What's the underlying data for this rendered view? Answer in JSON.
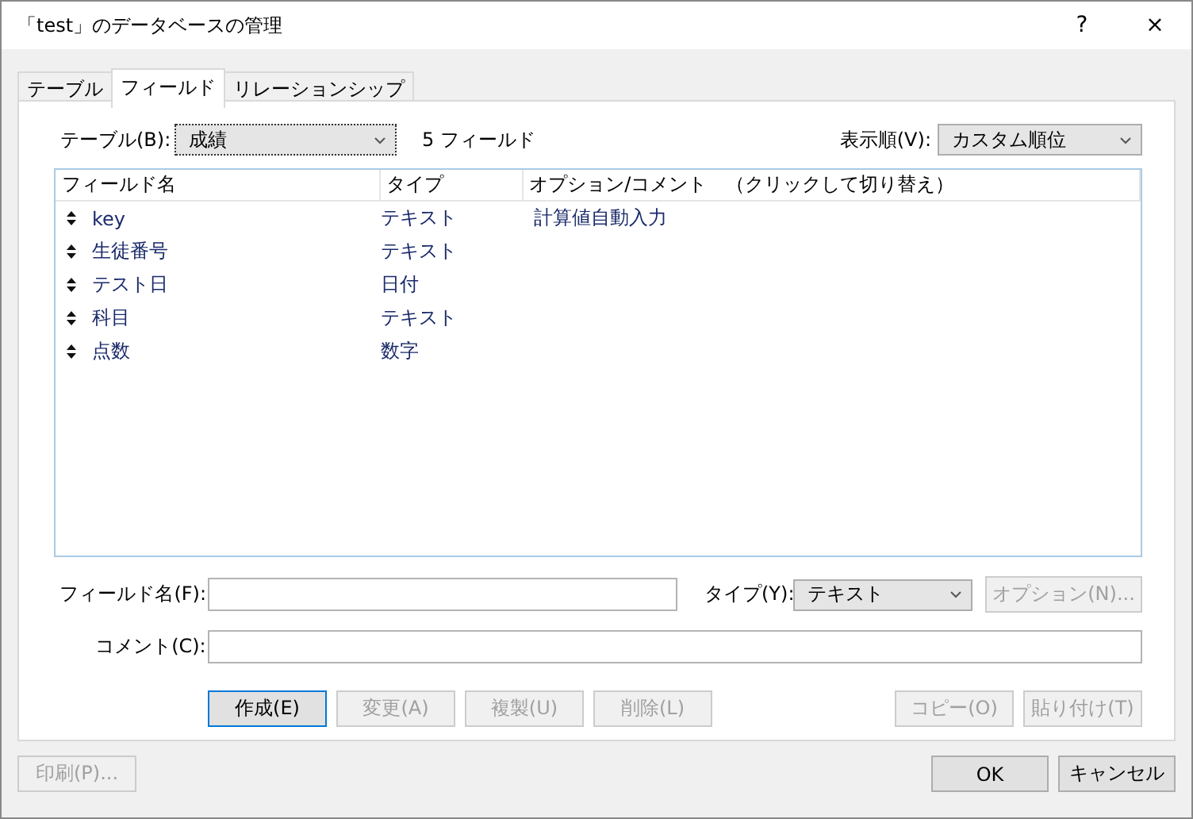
{
  "window": {
    "title": "「test」のデータベースの管理",
    "help": "?",
    "close": "×"
  },
  "tabs": [
    {
      "label": "テーブル",
      "selected": false
    },
    {
      "label": "フィールド",
      "selected": true
    },
    {
      "label": "リレーションシップ",
      "selected": false
    }
  ],
  "table_select": {
    "label": "テーブル(B):",
    "value": "成績"
  },
  "field_count": "5 フィールド",
  "sort_select": {
    "label": "表示順(V):",
    "value": "カスタム順位"
  },
  "list": {
    "columns": [
      "フィールド名",
      "タイプ",
      "オプション/コメント　（クリックして切り替え）"
    ],
    "rows": [
      [
        "key",
        "テキスト",
        "計算値自動入力"
      ],
      [
        "生徒番号",
        "テキスト",
        ""
      ],
      [
        "テスト日",
        "日付",
        ""
      ],
      [
        "科目",
        "テキスト",
        ""
      ],
      [
        "点数",
        "数字",
        ""
      ]
    ]
  },
  "field_name": {
    "label": "フィールド名(F):"
  },
  "type_select": {
    "label": "タイプ(Y):",
    "value": "テキスト"
  },
  "options_button": {
    "label": "オプション(N)...",
    "disabled": true
  },
  "comment": {
    "label": "コメント(C):"
  },
  "edit_buttons": [
    {
      "label": "作成(E)",
      "disabled": false,
      "focused": true
    },
    {
      "label": "変更(A)",
      "disabled": true,
      "focused": false
    },
    {
      "label": "複製(U)",
      "disabled": true,
      "focused": false
    },
    {
      "label": "削除(L)",
      "disabled": true,
      "focused": false
    }
  ],
  "clip_buttons": [
    {
      "label": "コピー(O)",
      "disabled": true,
      "focused": false
    },
    {
      "label": "貼り付け(T)",
      "disabled": true,
      "focused": false
    }
  ],
  "print_button": {
    "label": "印刷(P)...",
    "disabled": true
  },
  "dialog_buttons": [
    {
      "label": "OK",
      "disabled": false
    },
    {
      "label": "キャンセル",
      "disabled": false
    }
  ]
}
